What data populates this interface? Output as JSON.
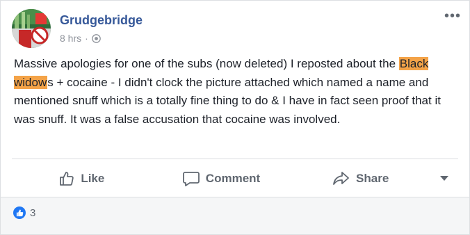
{
  "post": {
    "author": "Grudgebridge",
    "time": "8 hrs",
    "separator": "·",
    "text_before": "Massive apologies for one of the subs (now deleted) I reposted about the ",
    "highlight": "Black widow",
    "text_after": "s + cocaine - I didn't clock the picture attached which named a name and mentioned snuff which is a totally fine thing to do & I have in fact seen proof that it was snuff. It was a false accusation that cocaine was involved.",
    "more_label": "•••"
  },
  "actions": {
    "like": "Like",
    "comment": "Comment",
    "share": "Share"
  },
  "reactions": {
    "count": "3",
    "icon": "like-thumb-icon"
  },
  "colors": {
    "author": "#365899",
    "highlight": "#f4a348",
    "reaction": "#2078f4"
  }
}
